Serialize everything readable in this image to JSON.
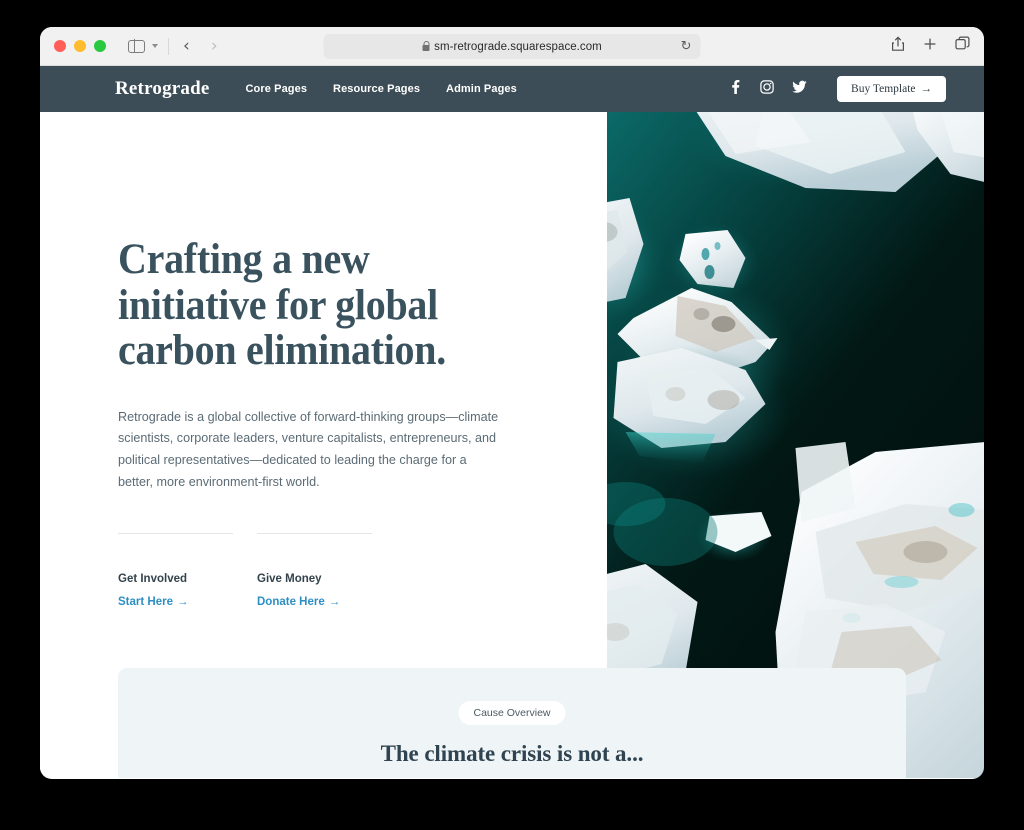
{
  "browser": {
    "traffic_lights": [
      "close",
      "minimize",
      "maximize"
    ],
    "sidebar_toggle_label": "Show Sidebar",
    "back_label": "‹",
    "forward_label": "›",
    "url": "sm-retrograde.squarespace.com",
    "reload_label": "↻",
    "share_label": "Share",
    "new_tab_label": "+",
    "tab_overview_label": "Show Tab Overview",
    "accent": "#f1f1f1"
  },
  "site_header": {
    "logo": "Retrograde",
    "nav": [
      {
        "label": "Core Pages"
      },
      {
        "label": "Resource Pages"
      },
      {
        "label": "Admin Pages"
      }
    ],
    "social": [
      {
        "name": "facebook-icon",
        "label": "Facebook"
      },
      {
        "name": "instagram-icon",
        "label": "Instagram"
      },
      {
        "name": "twitter-icon",
        "label": "Twitter"
      }
    ],
    "buy_button": "Buy Template",
    "buy_button_arrow": "→",
    "background": "#3c4d57"
  },
  "hero": {
    "headline": "Crafting a new initiative for global carbon elimination.",
    "paragraph": "Retrograde is a global collective of forward-thinking groups—climate scientists, corporate leaders, venture capitalists, entrepreneurs, and political representatives—dedicated to leading the charge for a better, more environment-first world.",
    "ctas": [
      {
        "title": "Get Involved",
        "link": "Start Here",
        "arrow": "→"
      },
      {
        "title": "Give Money",
        "link": "Donate Here",
        "arrow": "→"
      }
    ],
    "link_color": "#2e8fc4",
    "headline_color": "#39525e",
    "image_alt": "Aerial photograph of icebergs floating in dark teal arctic water"
  },
  "cause_section": {
    "badge": "Cause Overview",
    "heading": "The climate crisis is not a...",
    "background": "#eff4f7"
  }
}
